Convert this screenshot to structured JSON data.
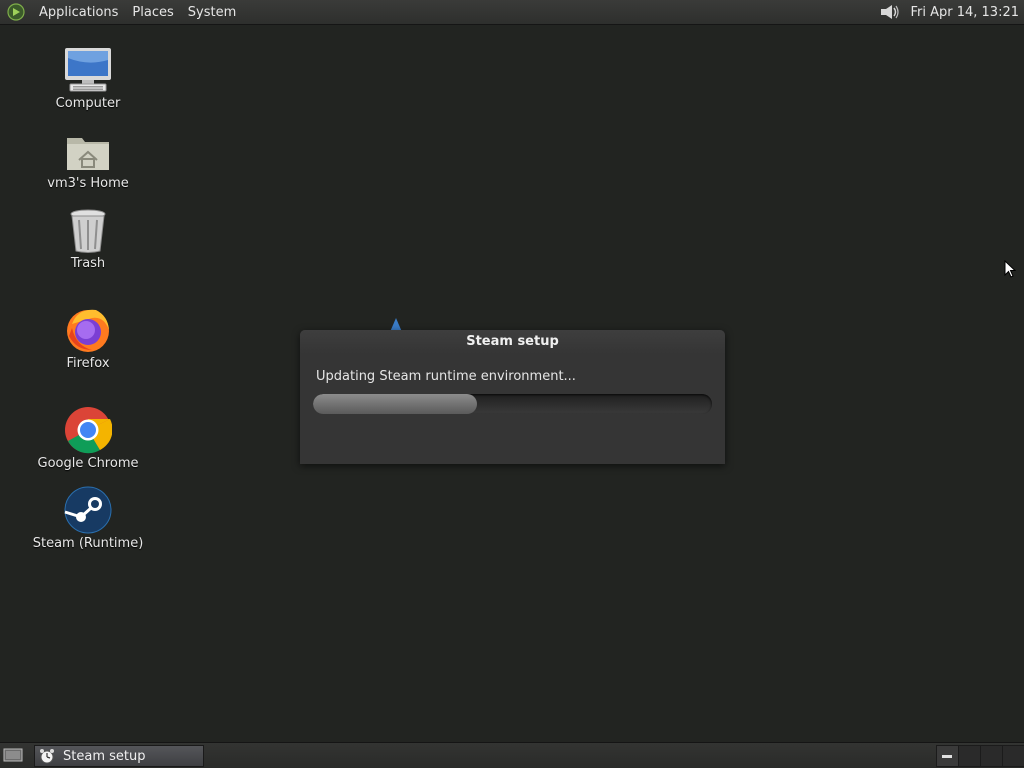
{
  "top_panel": {
    "menus": [
      "Applications",
      "Places",
      "System"
    ],
    "clock": "Fri Apr 14, 13:21",
    "icons": {
      "launcher": "gnome-foot-icon",
      "volume": "volume-icon"
    }
  },
  "desktop": {
    "icons": [
      {
        "label": "Computer",
        "icon": "computer-icon"
      },
      {
        "label": "vm3's Home",
        "icon": "home-folder-icon"
      },
      {
        "label": "Trash",
        "icon": "trash-icon"
      },
      {
        "label": "Firefox",
        "icon": "firefox-icon"
      },
      {
        "label": "Google Chrome",
        "icon": "chrome-icon"
      },
      {
        "label": "Steam (Runtime)",
        "icon": "steam-icon"
      }
    ]
  },
  "dialog": {
    "title": "Steam setup",
    "message": "Updating Steam runtime environment...",
    "progress": 0.41
  },
  "bottom_panel": {
    "task_label": "Steam setup",
    "icons": {
      "show_desktop": "show-desktop-icon",
      "task": "alarm-clock-icon"
    }
  },
  "colors": {
    "desktop_bg": "#222421",
    "panel_bg": "#2e2f2d",
    "dialog_bg": "#353535"
  }
}
